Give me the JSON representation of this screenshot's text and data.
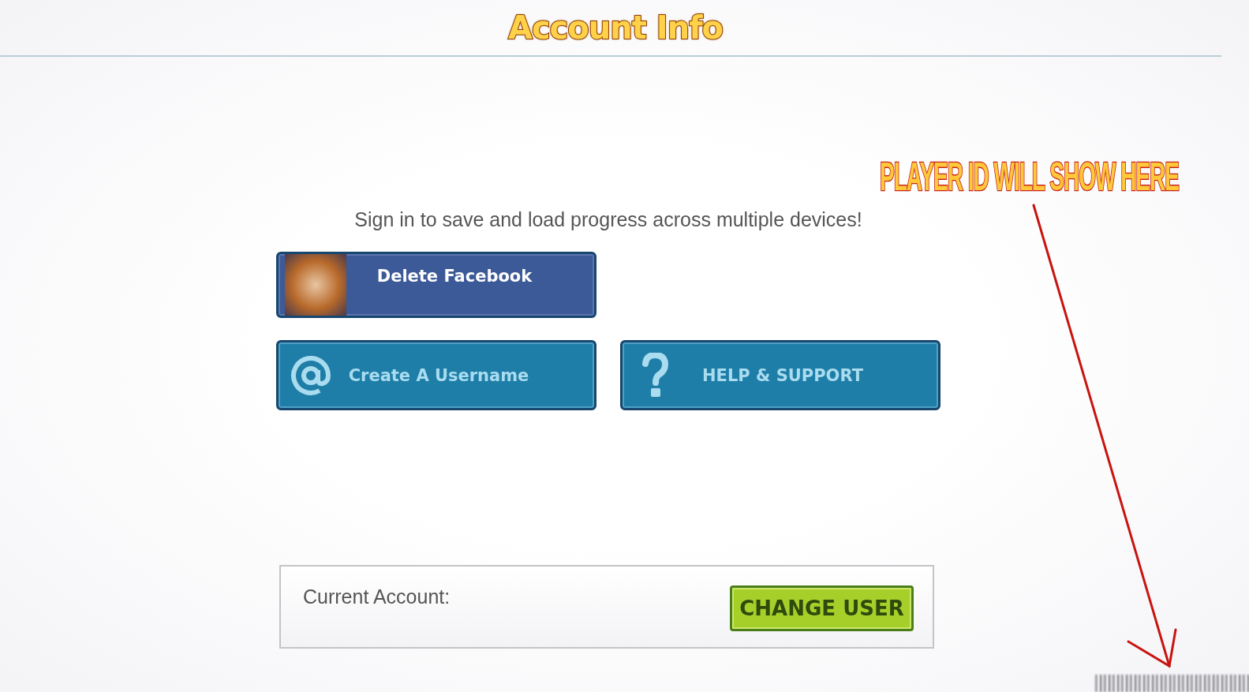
{
  "header": {
    "title": "Account Info"
  },
  "prompt": "Sign in to save and load progress across multiple devices!",
  "buttons": [
    {
      "kind": "facebook",
      "label": "Delete Facebook"
    },
    {
      "kind": "username",
      "label": "Create A Username"
    },
    {
      "kind": "help",
      "label": "HELP & SUPPORT"
    }
  ],
  "account": {
    "label": "Current Account:",
    "button": "CHANGE USER"
  },
  "annotation": {
    "text": "PLAYER ID WILL SHOW HERE"
  }
}
